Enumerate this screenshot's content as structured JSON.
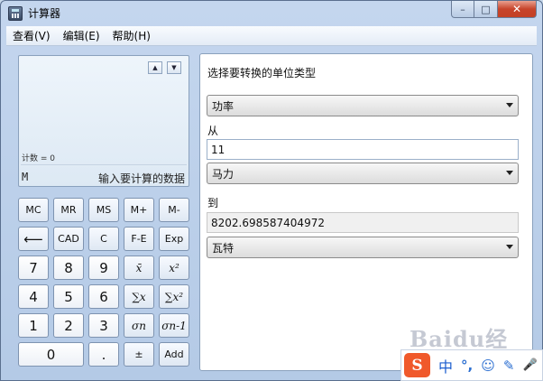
{
  "window": {
    "title": "计算器",
    "controls": {
      "minimize": "–",
      "maximize": "□",
      "close": "✕"
    }
  },
  "menu": [
    "查看(V)",
    "编辑(E)",
    "帮助(H)"
  ],
  "display": {
    "arrow_up": "▲",
    "arrow_down": "▼",
    "count_label": "计数 = 0",
    "memory_indicator": "M",
    "hint": "输入要计算的数据"
  },
  "keys": {
    "row1": [
      "MC",
      "MR",
      "MS",
      "M+",
      "M-"
    ],
    "row2": [
      "⟵",
      "CAD",
      "C",
      "F-E",
      "Exp"
    ],
    "row3": [
      "7",
      "8",
      "9",
      "x̄",
      "x²"
    ],
    "row4": [
      "4",
      "5",
      "6",
      "∑x",
      "∑x²"
    ],
    "row5": [
      "1",
      "2",
      "3",
      "σn",
      "σn-1"
    ],
    "row6": [
      "0",
      ".",
      "±",
      "Add"
    ]
  },
  "converter": {
    "heading": "选择要转换的单位类型",
    "unit_type": "功率",
    "from_label": "从",
    "from_value": "11",
    "from_unit": "马力",
    "to_label": "到",
    "to_value": "8202.698587404972",
    "to_unit": "瓦特"
  },
  "watermark": "Baidu经验",
  "ime": {
    "logo": "S",
    "lang": "中",
    "punct": "°,",
    "emoji_icon": "☺",
    "pen_icon": "✎",
    "mic_icon": "🎤"
  }
}
